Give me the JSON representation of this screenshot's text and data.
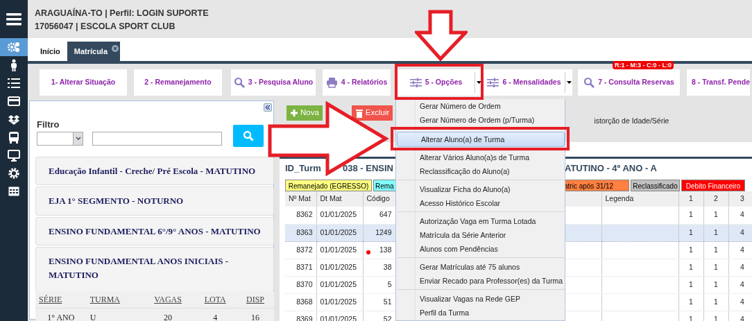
{
  "header": {
    "line_1": "ARAGUAÍNA-TO | Perfil: LOGIN SUPORTE",
    "line_2": "17056047 | ESCOLA SPORT CLUB"
  },
  "sidebar": {
    "items": [
      {
        "selected": false
      },
      {
        "selected": true
      },
      {
        "selected": false
      },
      {
        "selected": false
      },
      {
        "selected": false
      },
      {
        "selected": false
      },
      {
        "selected": false
      },
      {
        "selected": false
      },
      {
        "selected": false
      },
      {
        "selected": false
      }
    ]
  },
  "tabs": [
    {
      "label": "Início",
      "selected": false,
      "closable": false
    },
    {
      "label": "Matrícula",
      "selected": true,
      "closable": true
    }
  ],
  "toolbar": [
    {
      "label": "1- Alterar Situação",
      "kind": "plain",
      "split": false
    },
    {
      "label": "2 - Remanejamento",
      "kind": "plain",
      "split": false
    },
    {
      "label": "3 - Pesquisa Aluno",
      "kind": "search",
      "split": false
    },
    {
      "label": "4 - Relatórios",
      "kind": "print",
      "split": false
    },
    {
      "label": "5 - Opções",
      "kind": "options",
      "split": true
    },
    {
      "label": "6 - Mensalidades",
      "kind": "options",
      "split": true
    },
    {
      "label": "7 - Consulta Reservas",
      "kind": "search",
      "split": false,
      "badge": "R:1 - M:3 - C:0 - L:0"
    },
    {
      "label": "8 - Transf. Pende",
      "kind": "plain",
      "split": false
    }
  ],
  "filter_panel": {
    "title": "Filtro",
    "groups": [
      {
        "label": "Educação Infantil - Creche/ Pré Escola - MATUTINO",
        "expanded": false
      },
      {
        "label": "EJA 1° SEGMENTO - NOTURNO",
        "expanded": false
      },
      {
        "label": "ENSINO FUNDAMENTAL 6°/9° ANOS - MATUTINO",
        "expanded": false
      },
      {
        "label": "ENSINO FUNDAMENTAL ANOS INICIAIS - MATUTINO",
        "expanded": true,
        "table": {
          "columns": [
            "SÉRIE",
            "TURMA",
            "VAGAS",
            "LOTA",
            "DISP"
          ],
          "rows": [
            [
              "1° ANO",
              "U",
              "20",
              "4",
              "16"
            ]
          ]
        }
      }
    ]
  },
  "actions": [
    {
      "label": "Nova",
      "kind": "add"
    },
    {
      "label": "Excluir",
      "kind": "delete"
    }
  ],
  "option_label": "istorção de Idade/Série",
  "class_title": [
    "ID_Turm",
    "038 - ENSIN",
    "ATUTINO - 4º ANO - A"
  ],
  "legend": [
    {
      "label": "Remanejado (EGRESSO)",
      "color": "#ffff80"
    },
    {
      "label": "Rema",
      "color": "#80ffff"
    },
    {
      "label": "atric após 31/12",
      "color": "#ff8040"
    },
    {
      "label": "Reclassificado",
      "color": "#c0c0c0"
    },
    {
      "label": "Debito Financeiro",
      "color": "#ff0000"
    }
  ],
  "table": {
    "columns": [
      "Nº Mat",
      "Dt Mat",
      "Código",
      "Legenda",
      "1",
      "2",
      "3"
    ],
    "rows": [
      {
        "cells": [
          "8362",
          "01/01/2025",
          "647",
          "",
          "1",
          "1",
          "4"
        ],
        "selected": false,
        "flagged": false
      },
      {
        "cells": [
          "8363",
          "01/01/2025",
          "1249",
          "",
          "1",
          "1",
          "4"
        ],
        "selected": true,
        "flagged": false
      },
      {
        "cells": [
          "8372",
          "01/01/2025",
          "138",
          "",
          "1",
          "1",
          "4"
        ],
        "selected": false,
        "flagged": true
      },
      {
        "cells": [
          "8371",
          "01/01/2025",
          "38",
          "",
          "1",
          "1",
          "4"
        ],
        "selected": false,
        "flagged": false
      },
      {
        "cells": [
          "8370",
          "01/01/2025",
          "5",
          "",
          "1",
          "1",
          "4"
        ],
        "selected": false,
        "flagged": false
      },
      {
        "cells": [
          "8368",
          "01/01/2025",
          "51",
          "",
          "1",
          "1",
          "4"
        ],
        "selected": false,
        "flagged": false
      },
      {
        "cells": [
          "8369",
          "01/01/2025",
          "52",
          "",
          "1",
          "1",
          "4"
        ],
        "selected": false,
        "flagged": false
      }
    ]
  },
  "options_menu": {
    "groups": [
      [
        {
          "label": "Gerar Número de Ordem",
          "selected": false
        },
        {
          "label": "Gerar Número de Ordem (p/Turma)",
          "selected": false
        },
        {
          "label": "Alterar Aluno(a) de Turma",
          "selected": true
        },
        {
          "label": "Alterar Vários Aluno(a)s de Turma",
          "selected": false
        },
        {
          "label": "Reclassificação do Aluno(a)",
          "selected": false
        }
      ],
      [
        {
          "label": "Visualizar Ficha do Aluno(a)",
          "selected": false
        },
        {
          "label": "Acesso Histórico Escolar",
          "selected": false
        }
      ],
      [
        {
          "label": "Autorização Vaga em Turma Lotada",
          "selected": false
        },
        {
          "label": "Matrícula da Série Anterior",
          "selected": false
        },
        {
          "label": "Alunos com Pendências",
          "selected": false
        }
      ],
      [
        {
          "label": "Gerar Matrículas até 75 alunos",
          "selected": false
        },
        {
          "label": "Enviar Recado para Professor(es) da Turma",
          "selected": false
        }
      ],
      [
        {
          "label": "Visualizar Vagas na Rede GEP",
          "selected": false
        },
        {
          "label": "Perfil da Turma",
          "selected": false
        }
      ]
    ]
  }
}
